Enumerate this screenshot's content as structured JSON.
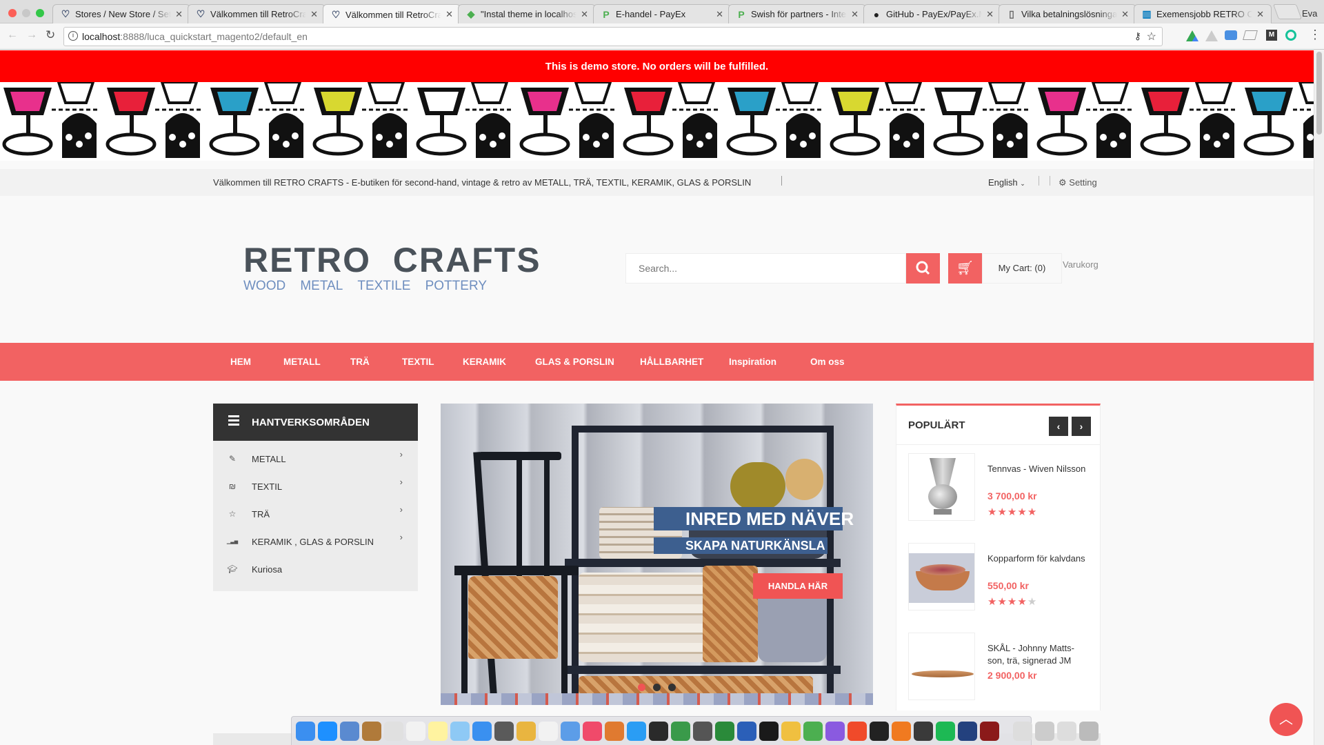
{
  "browser": {
    "tabs": [
      {
        "title": "Stores / New Store / Set",
        "icon": "magento-icon"
      },
      {
        "title": "Välkommen till RetroCraf",
        "icon": "magento-icon"
      },
      {
        "title": "Välkommen till RetroCraf",
        "icon": "magento-icon",
        "active": true
      },
      {
        "title": "\"Instal theme in localhos",
        "icon": "tag-icon"
      },
      {
        "title": "E-handel - PayEx",
        "icon": "payex-icon"
      },
      {
        "title": "Swish för partners - Integ",
        "icon": "payex-icon"
      },
      {
        "title": "GitHub - PayEx/PayEx.M",
        "icon": "github-icon"
      },
      {
        "title": "Vilka betalningslösningar",
        "icon": "document-icon"
      },
      {
        "title": "Exemensjobb RETRO CR",
        "icon": "trello-icon"
      }
    ],
    "user": "Eva",
    "url_host": "localhost",
    "url_rest": ":8888/luca_quickstart_magento2/default_en"
  },
  "demo_notice": "This is demo store. No orders will be fulfilled.",
  "topbar": {
    "welcome": "Välkommen till RETRO CRAFTS - E-butiken för second-hand, vintage & retro av METALL, TRÄ, TEXTIL, KERAMIK, GLAS & PORSLIN",
    "language": "English",
    "setting": "Setting"
  },
  "logo": {
    "title1": "RETRO",
    "title2": "CRAFTS",
    "sub": [
      "WOOD",
      "METAL",
      "TEXTILE",
      "POTTERY"
    ]
  },
  "search": {
    "placeholder": "Search...",
    "cart_label": "My Cart:",
    "cart_count": "(0)",
    "cart_link": "Varukorg"
  },
  "nav": [
    "HEM",
    "METALL",
    "TRÄ",
    "TEXTIL",
    "KERAMIK",
    "GLAS & PORSLIN",
    "HÅLLBARHET",
    "Inspiration",
    "Om oss"
  ],
  "sidebar": {
    "title": "HANTVERKSOMRÅDEN",
    "items": [
      {
        "label": "METALL",
        "icon": "plug-icon",
        "sub": true
      },
      {
        "label": "TEXTIL",
        "icon": "shekel-icon",
        "sub": true
      },
      {
        "label": "TRÄ",
        "icon": "star-half-icon",
        "sub": true
      },
      {
        "label": "KERAMIK , GLAS & PORSLIN",
        "icon": "signal-icon",
        "sub": true
      },
      {
        "label": "Kuriosa",
        "icon": "graduation-cap-icon",
        "sub": false
      }
    ]
  },
  "slider": {
    "headline": "INRED MED NÄVER",
    "subline": "SKAPA NATURKÄNSLA",
    "cta": "HANDLA HÄR",
    "slide_count": 3,
    "active_slide": 1
  },
  "popular": {
    "title": "POPULÄRT",
    "products": [
      {
        "name": "Tennvas - Wiven Nilsson",
        "price": "3 700,00 kr",
        "rating": 5
      },
      {
        "name": "Kopparform för kalvdans",
        "price": "550,00 kr",
        "rating": 4
      },
      {
        "name": "SKÅL - Johnny Matts-son, trä, signerad JM",
        "price": "2 900,00 kr",
        "rating": null
      }
    ]
  },
  "colors": {
    "accent": "#f26262",
    "demo": "#ff0000",
    "dark": "#333333",
    "slider_blue": "#3d5f8f"
  }
}
